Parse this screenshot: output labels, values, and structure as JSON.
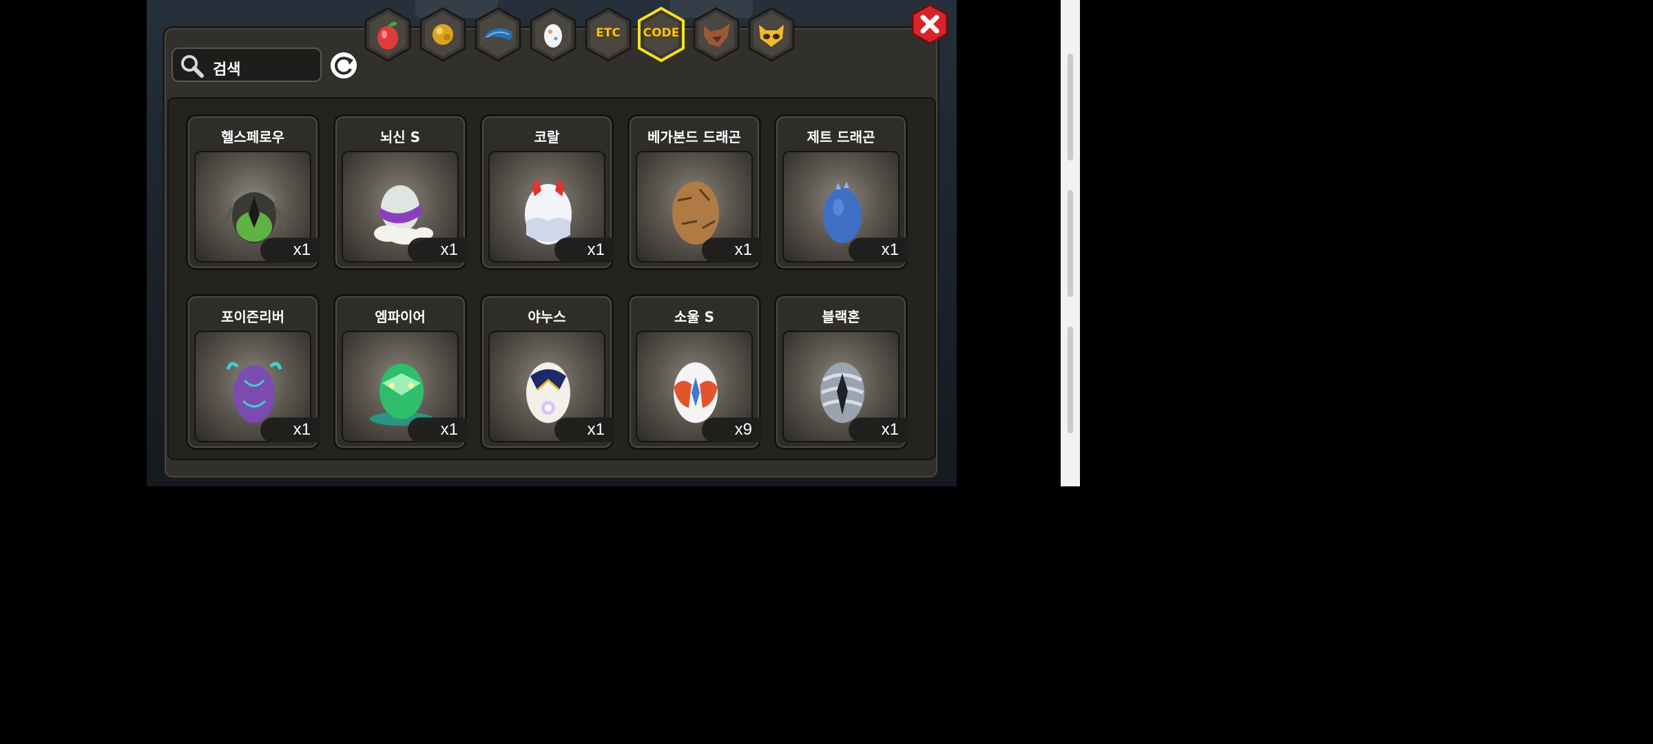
{
  "search": {
    "placeholder": "검색"
  },
  "tabs": [
    {
      "name": "fruit",
      "label": ""
    },
    {
      "name": "gold",
      "label": ""
    },
    {
      "name": "dragon",
      "label": ""
    },
    {
      "name": "egg",
      "label": ""
    },
    {
      "name": "etc",
      "label": "ETC"
    },
    {
      "name": "code",
      "label": "CODE",
      "selected": true
    },
    {
      "name": "wolf",
      "label": ""
    },
    {
      "name": "mask",
      "label": ""
    }
  ],
  "items": [
    {
      "name": "헬스페로우",
      "count": "x1",
      "icon": "hellsparrow-egg",
      "color": "#3a3a34",
      "accent": "#6bd14a"
    },
    {
      "name": "뇌신 S",
      "count": "x1",
      "icon": "thunder-god-egg",
      "color": "#dfe6e2",
      "accent": "#8a3fbf"
    },
    {
      "name": "코랄",
      "count": "x1",
      "icon": "coral-egg",
      "color": "#f2f4fa",
      "accent": "#e0352f"
    },
    {
      "name": "베가본드 드래곤",
      "count": "x1",
      "icon": "vagabond-dragon-egg",
      "color": "#b07a45",
      "accent": "#5a3c22"
    },
    {
      "name": "제트 드래곤",
      "count": "x1",
      "icon": "jet-dragon-egg",
      "color": "#3f6fc4",
      "accent": "#8fb0e8"
    },
    {
      "name": "포이즌리버",
      "count": "x1",
      "icon": "poison-river-egg",
      "color": "#7b4bb0",
      "accent": "#3fd0c8"
    },
    {
      "name": "엠파이어",
      "count": "x1",
      "icon": "empire-egg",
      "color": "#2fbf6a",
      "accent": "#9ef0b8"
    },
    {
      "name": "야누스",
      "count": "x1",
      "icon": "janus-egg",
      "color": "#f2f0ea",
      "accent": "#1c2a6a"
    },
    {
      "name": "소울 S",
      "count": "x9",
      "icon": "soul-egg",
      "color": "#f4f4f4",
      "accent": "#e2552a"
    },
    {
      "name": "블랙혼",
      "count": "x1",
      "icon": "black-horn-egg",
      "color": "#9aa4b0",
      "accent": "#1e2228"
    }
  ],
  "colors": {
    "tab_selected_border": "#f5e11a",
    "close_red": "#d8232a",
    "tab_label": "#f5c518"
  }
}
